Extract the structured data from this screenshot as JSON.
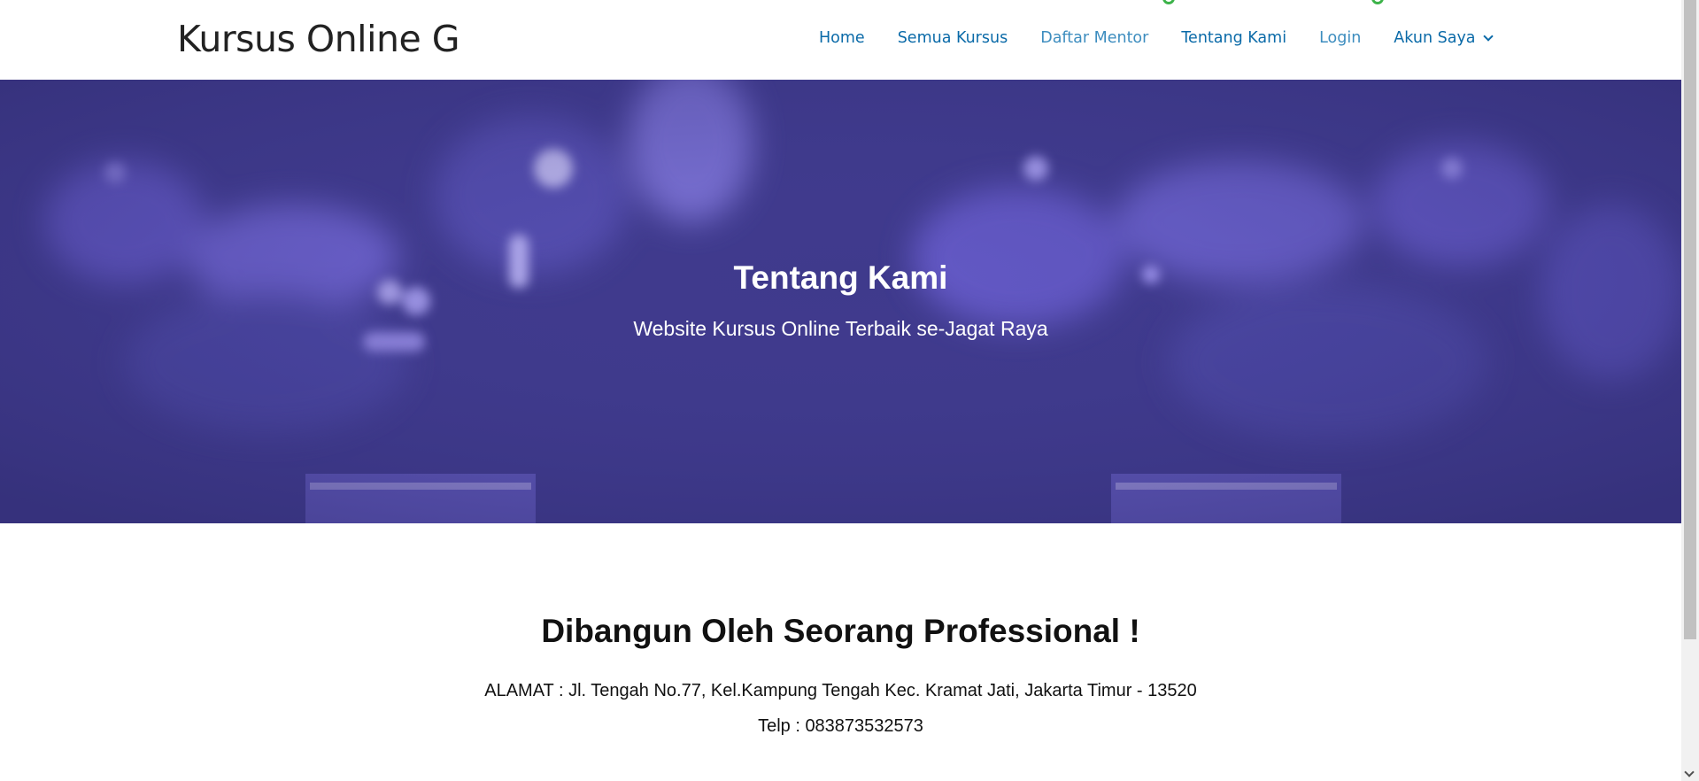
{
  "header": {
    "site_title": "Kursus Online G",
    "nav": {
      "home": "Home",
      "semua_kursus": "Semua Kursus",
      "daftar_mentor": "Daftar Mentor",
      "tentang_kami": "Tentang Kami",
      "login": "Login",
      "akun_saya": "Akun Saya"
    }
  },
  "hero": {
    "title": "Tentang Kami",
    "subtitle": "Website Kursus Online Terbaik se-Jagat Raya",
    "overlay_color": "#3f3a8c"
  },
  "about": {
    "heading": "Dibangun Oleh Seorang Professional !",
    "address": "ALAMAT : Jl. Tengah No.77, Kel.Kampung Tengah Kec. Kramat Jati, Jakarta Timur - 13520",
    "phone": "Telp : 083873532573"
  },
  "colors": {
    "link": "#0a6aa8",
    "link_light": "#3d8dbf",
    "accent_green": "#3db34a"
  },
  "icons": {
    "dropdown": "chevron-down-icon",
    "status_dots": "green-ring-icon"
  }
}
